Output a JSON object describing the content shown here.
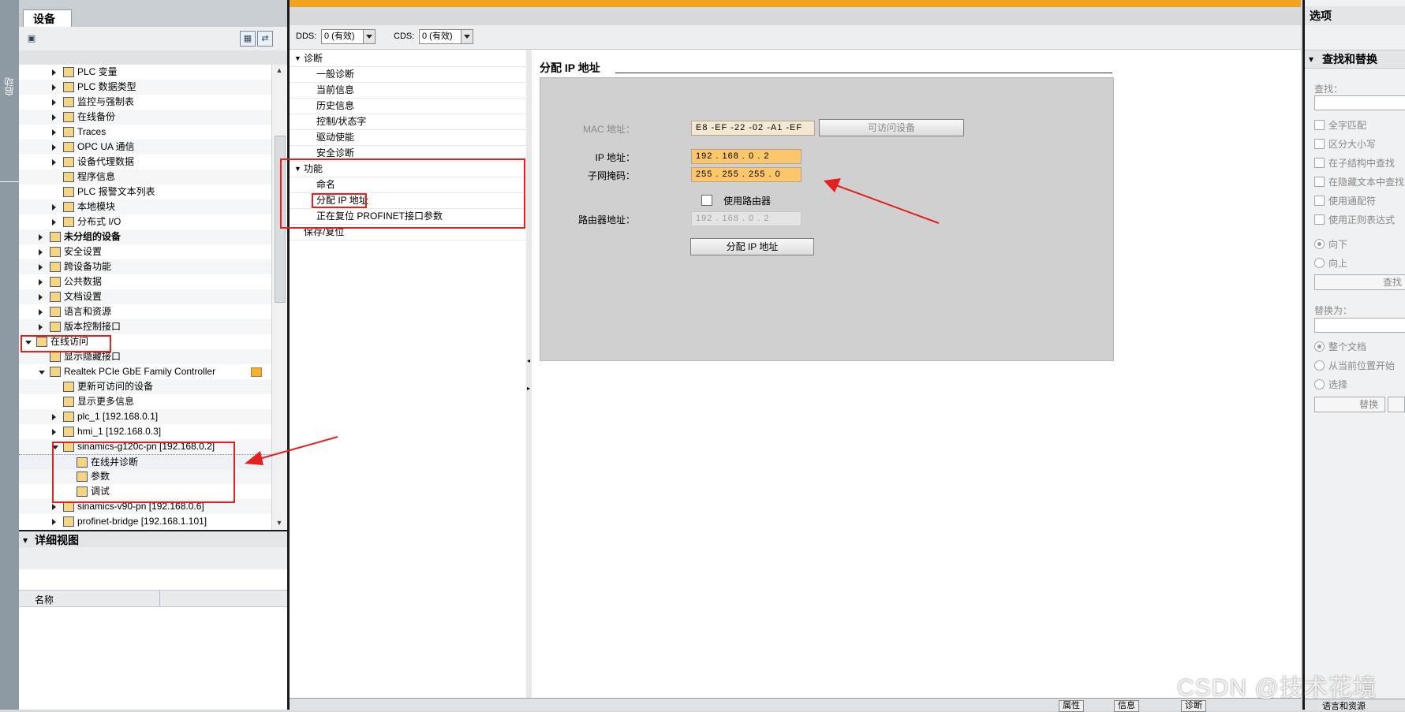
{
  "left_strip": {
    "label": "启动"
  },
  "project_tree": {
    "tab_label": "设备",
    "items": [
      {
        "label": "PLC 变量",
        "level": 2,
        "state": "collapsed",
        "bold": false
      },
      {
        "label": "PLC 数据类型",
        "level": 2,
        "state": "collapsed",
        "bold": false
      },
      {
        "label": "监控与强制表",
        "level": 2,
        "state": "collapsed",
        "bold": false
      },
      {
        "label": "在线备份",
        "level": 2,
        "state": "collapsed",
        "bold": false
      },
      {
        "label": "Traces",
        "level": 2,
        "state": "collapsed",
        "bold": false
      },
      {
        "label": "OPC UA 通信",
        "level": 2,
        "state": "collapsed",
        "bold": false
      },
      {
        "label": "设备代理数据",
        "level": 2,
        "state": "collapsed",
        "bold": false
      },
      {
        "label": "程序信息",
        "level": 2,
        "state": "leaf",
        "bold": false
      },
      {
        "label": "PLC 报警文本列表",
        "level": 2,
        "state": "leaf",
        "bold": false
      },
      {
        "label": "本地模块",
        "level": 2,
        "state": "collapsed",
        "bold": false
      },
      {
        "label": "分布式 I/O",
        "level": 2,
        "state": "collapsed",
        "bold": false
      },
      {
        "label": "未分组的设备",
        "level": 1,
        "state": "collapsed",
        "bold": true
      },
      {
        "label": "安全设置",
        "level": 1,
        "state": "collapsed",
        "bold": false
      },
      {
        "label": "跨设备功能",
        "level": 1,
        "state": "collapsed",
        "bold": false
      },
      {
        "label": "公共数据",
        "level": 1,
        "state": "collapsed",
        "bold": false
      },
      {
        "label": "文档设置",
        "level": 1,
        "state": "collapsed",
        "bold": false
      },
      {
        "label": "语言和资源",
        "level": 1,
        "state": "collapsed",
        "bold": false
      },
      {
        "label": "版本控制接口",
        "level": 1,
        "state": "collapsed",
        "bold": false
      },
      {
        "label": "在线访问",
        "level": 0,
        "state": "expanded",
        "bold": false
      },
      {
        "label": "显示隐藏接口",
        "level": 1,
        "state": "leaf",
        "bold": false
      },
      {
        "label": "Realtek PCIe GbE Family Controller",
        "level": 1,
        "state": "expanded",
        "bold": false
      },
      {
        "label": "更新可访问的设备",
        "level": 2,
        "state": "leaf",
        "bold": false
      },
      {
        "label": "显示更多信息",
        "level": 2,
        "state": "leaf",
        "bold": false
      },
      {
        "label": "plc_1 [192.168.0.1]",
        "level": 2,
        "state": "collapsed",
        "bold": false
      },
      {
        "label": "hmi_1 [192.168.0.3]",
        "level": 2,
        "state": "collapsed",
        "bold": false
      },
      {
        "label": "sinamics-g120c-pn [192.168.0.2]",
        "level": 2,
        "state": "expanded",
        "bold": false
      },
      {
        "label": "在线并诊断",
        "level": 3,
        "state": "leaf",
        "bold": false
      },
      {
        "label": "参数",
        "level": 3,
        "state": "leaf",
        "bold": false
      },
      {
        "label": "调试",
        "level": 3,
        "state": "leaf",
        "bold": false
      },
      {
        "label": "sinamics-v90-pn [192.168.0.6]",
        "level": 2,
        "state": "collapsed",
        "bold": false
      },
      {
        "label": "profinet-bridge [192.168.1.101]",
        "level": 2,
        "state": "collapsed",
        "bold": false
      }
    ]
  },
  "detail_view": {
    "title": "详细视图",
    "column_name": "名称"
  },
  "toolbar": {
    "dds_label": "DDS:",
    "dds_value": "0 (有效)",
    "cds_label": "CDS:",
    "cds_value": "0 (有效)"
  },
  "nav": {
    "groups": [
      {
        "label": "诊断",
        "items": [
          "一般诊断",
          "当前信息",
          "历史信息",
          "控制/状态字",
          "驱动使能",
          "安全诊断"
        ]
      },
      {
        "label": "功能",
        "items": [
          "命名",
          "分配 IP 地址",
          "正在复位 PROFINET接口参数"
        ]
      }
    ],
    "footer_item": "保存/复位"
  },
  "assign_ip": {
    "title": "分配 IP 地址",
    "mac_label": "MAC 地址：",
    "mac_value": "E8 -EF -22 -02 -A1 -EF",
    "accessible_devices_button": "可访问设备",
    "ip_label": "IP 地址：",
    "ip_value": "192 . 168 . 0   . 2",
    "subnet_label": "子网掩码：",
    "subnet_value": "255 . 255 . 255 . 0",
    "use_router_label": "使用路由器",
    "router_label": "路由器地址：",
    "router_value": "192 . 168 . 0   . 2",
    "assign_button": "分配 IP 地址"
  },
  "options_pane": {
    "title": "选项",
    "section": "查找和替换",
    "find_label": "查找：",
    "checkboxes": [
      "全字匹配",
      "区分大小写",
      "在子结构中查找",
      "在隐藏文本中查找",
      "使用通配符",
      "使用正则表达式"
    ],
    "direction": [
      "向下",
      "向上"
    ],
    "find_button": "查找",
    "replace_label": "替换为：",
    "scope": [
      "整个文档",
      "从当前位置开始",
      "选择"
    ],
    "replace_button": "替换"
  },
  "bottom_tabs": [
    "属性",
    "信息",
    "诊断"
  ],
  "bottom_right": "语言和资源",
  "watermark": "CSDN @技术花境",
  "colors": {
    "accent": "#f4a31c",
    "annotation": "#e3211f",
    "input_highlight": "#fcc76a"
  }
}
